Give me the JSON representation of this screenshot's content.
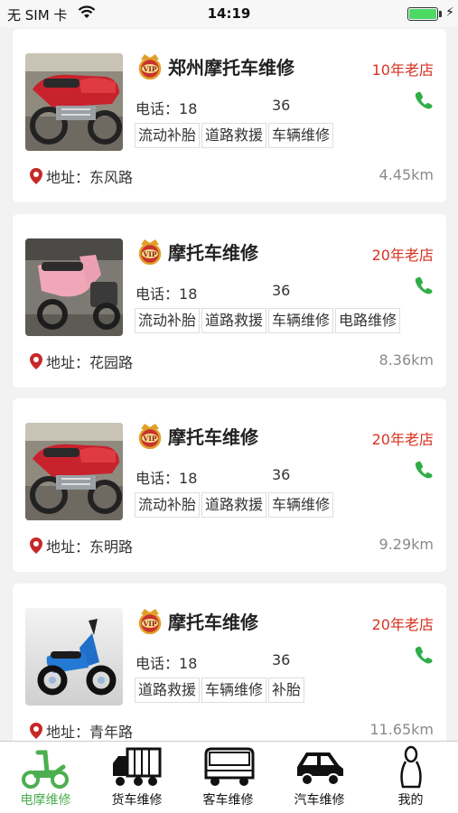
{
  "status_bar": {
    "carrier": "无 SIM 卡",
    "time": "14:19",
    "battery_level": 1.0,
    "battery_color": "#4cd964"
  },
  "shops": [
    {
      "name": "郑州摩托车维修",
      "age": "10年老店",
      "phone_label": "电话：",
      "phone_start": "18",
      "phone_end": "36",
      "tags": [
        "流动补胎",
        "道路救援",
        "车辆维修"
      ],
      "address_label": "地址：",
      "address": "东风路",
      "distance": "4.45km",
      "photo": "red-motorcycle"
    },
    {
      "name": "摩托车维修",
      "age": "20年老店",
      "phone_label": "电话：",
      "phone_start": "18",
      "phone_end": "36",
      "tags": [
        "流动补胎",
        "道路救援",
        "车辆维修",
        "电路维修"
      ],
      "address_label": "地址：",
      "address": "花园路",
      "distance": "8.36km",
      "photo": "pink-scooter"
    },
    {
      "name": "摩托车维修",
      "age": "20年老店",
      "phone_label": "电话：",
      "phone_start": "18",
      "phone_end": "36",
      "tags": [
        "流动补胎",
        "道路救援",
        "车辆维修"
      ],
      "address_label": "地址：",
      "address": "东明路",
      "distance": "9.29km",
      "photo": "red-motorcycle"
    },
    {
      "name": "摩托车维修",
      "age": "20年老店",
      "phone_label": "电话：",
      "phone_start": "18",
      "phone_end": "36",
      "tags": [
        "道路救援",
        "车辆维修",
        "补胎"
      ],
      "address_label": "地址：",
      "address": "青年路",
      "distance": "11.65km",
      "photo": "blue-scooter"
    }
  ],
  "tabs": [
    {
      "label": "电摩维修",
      "icon": "scooter-icon",
      "active": true
    },
    {
      "label": "货车维修",
      "icon": "truck-icon",
      "active": false
    },
    {
      "label": "客车维修",
      "icon": "bus-icon",
      "active": false
    },
    {
      "label": "汽车维修",
      "icon": "car-icon",
      "active": false
    },
    {
      "label": "我的",
      "icon": "person-icon",
      "active": false
    }
  ],
  "colors": {
    "accent_red": "#d6321f",
    "call_green": "#2fae48",
    "tab_active": "#4caf50"
  }
}
